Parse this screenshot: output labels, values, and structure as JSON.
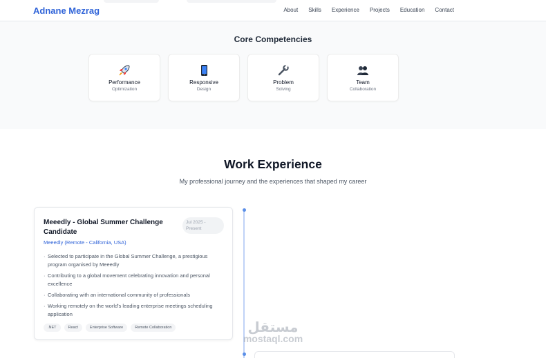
{
  "nav": {
    "brand": "Adnane Mezrag",
    "links": [
      "About",
      "Skills",
      "Experience",
      "Projects",
      "Education",
      "Contact"
    ]
  },
  "competencies": {
    "title": "Core Competencies",
    "items": [
      {
        "title": "Performance",
        "subtitle": "Optimization",
        "icon": "rocket-icon"
      },
      {
        "title": "Responsive",
        "subtitle": "Design",
        "icon": "phone-icon"
      },
      {
        "title": "Problem",
        "subtitle": "Solving",
        "icon": "wrench-icon"
      },
      {
        "title": "Team",
        "subtitle": "Collaboration",
        "icon": "team-icon"
      }
    ]
  },
  "experience": {
    "title": "Work Experience",
    "subtitle": "My professional journey and the experiences that shaped my career",
    "items": [
      {
        "title": "Meeedly - Global Summer Challenge Candidate",
        "date_line1": "Jul 2025 -",
        "date_line2": "Present",
        "company": "Meeedly (Remote - California, USA)",
        "bullets": [
          "Selected to participate in the Global Summer Challenge, a prestigious program organised by Meeedly",
          "Contributing to a global movement celebrating innovation and personal excellence",
          "Collaborating with an international community of professionals",
          "Working remotely on the world's leading enterprise meetings scheduling application"
        ],
        "tags": [
          ".NET",
          "React",
          "Enterprise Software",
          "Remote Collaboration"
        ]
      }
    ]
  },
  "watermark": {
    "arabic": "مستقل",
    "latin": "mostaql.com"
  },
  "colors": {
    "accent": "#2f63d8",
    "section_bg": "#f9fafb",
    "timeline": "#bfd2f7"
  }
}
